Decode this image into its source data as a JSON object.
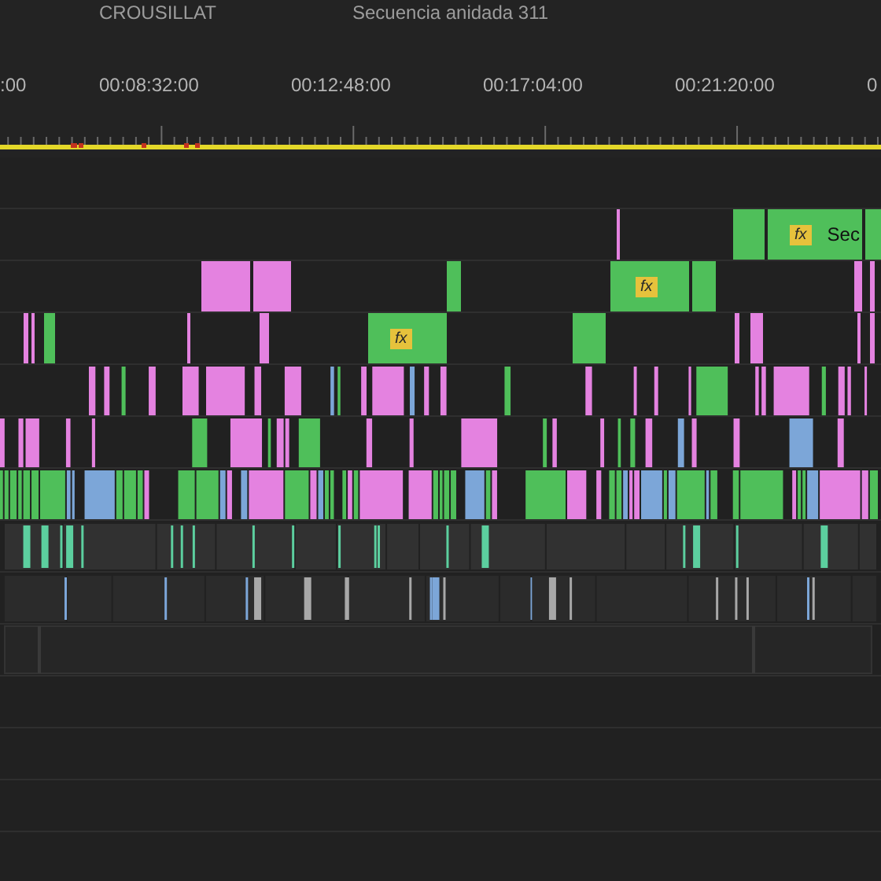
{
  "tabs": [
    {
      "label": "CROUSILLAT"
    },
    {
      "label": "Secuencia anidada 311"
    }
  ],
  "ruler": {
    "labels": [
      ":00",
      "00:08:32:00",
      "00:12:48:00",
      "00:17:04:00",
      "00:21:20:00",
      "0"
    ]
  },
  "tracks": [
    {
      "kind": "empty"
    },
    {
      "kind": "video-sparse",
      "clips": [
        {
          "badge": "fx",
          "title": "Sec"
        }
      ]
    },
    {
      "kind": "video-sparse",
      "clips": [
        {
          "badge": "fx"
        }
      ]
    },
    {
      "kind": "video-sparse",
      "clips": [
        {
          "badge": "fx"
        }
      ]
    },
    {
      "kind": "video"
    },
    {
      "kind": "video"
    },
    {
      "kind": "video"
    },
    {
      "kind": "audio"
    },
    {
      "kind": "audio"
    },
    {
      "kind": "audio-empty"
    },
    {
      "kind": "empty"
    },
    {
      "kind": "empty"
    },
    {
      "kind": "empty"
    },
    {
      "kind": "empty"
    }
  ]
}
